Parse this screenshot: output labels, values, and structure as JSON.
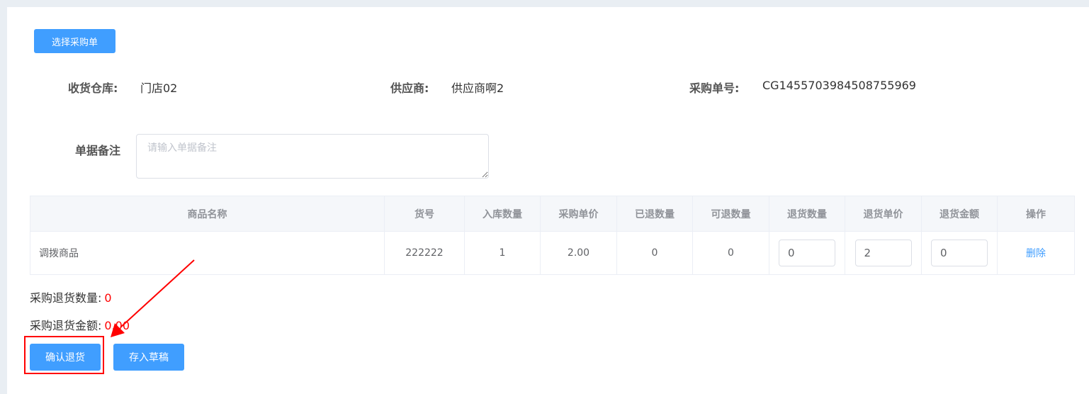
{
  "toolbar": {
    "select_order_label": "选择采购单"
  },
  "info": {
    "warehouse_label": "收货仓库:",
    "warehouse_value": "门店02",
    "supplier_label": "供应商:",
    "supplier_value": "供应商啊2",
    "order_no_label": "采购单号:",
    "order_no_value": "CG1455703984508755969"
  },
  "remark": {
    "label": "单据备注",
    "placeholder": "请输入单据备注",
    "value": ""
  },
  "table": {
    "columns": [
      "商品名称",
      "货号",
      "入库数量",
      "采购单价",
      "已退数量",
      "可退数量",
      "退货数量",
      "退货单价",
      "退货金额",
      "操作"
    ],
    "rows": [
      {
        "name": "调拨商品",
        "sku": "222222",
        "in_qty": "1",
        "unit_price": "2.00",
        "returned_qty": "0",
        "returnable_qty": "0",
        "return_qty": "0",
        "return_price": "2",
        "return_amount": "0",
        "action": "删除"
      }
    ]
  },
  "summary": {
    "qty_label": "采购退货数量:",
    "qty_value": "0",
    "amount_label": "采购退货金额:",
    "amount_value": "0.00"
  },
  "actions": {
    "confirm_label": "确认退货",
    "draft_label": "存入草稿"
  },
  "colors": {
    "primary": "#409eff",
    "annotation": "#ff0000",
    "amount": "#ff0000"
  }
}
